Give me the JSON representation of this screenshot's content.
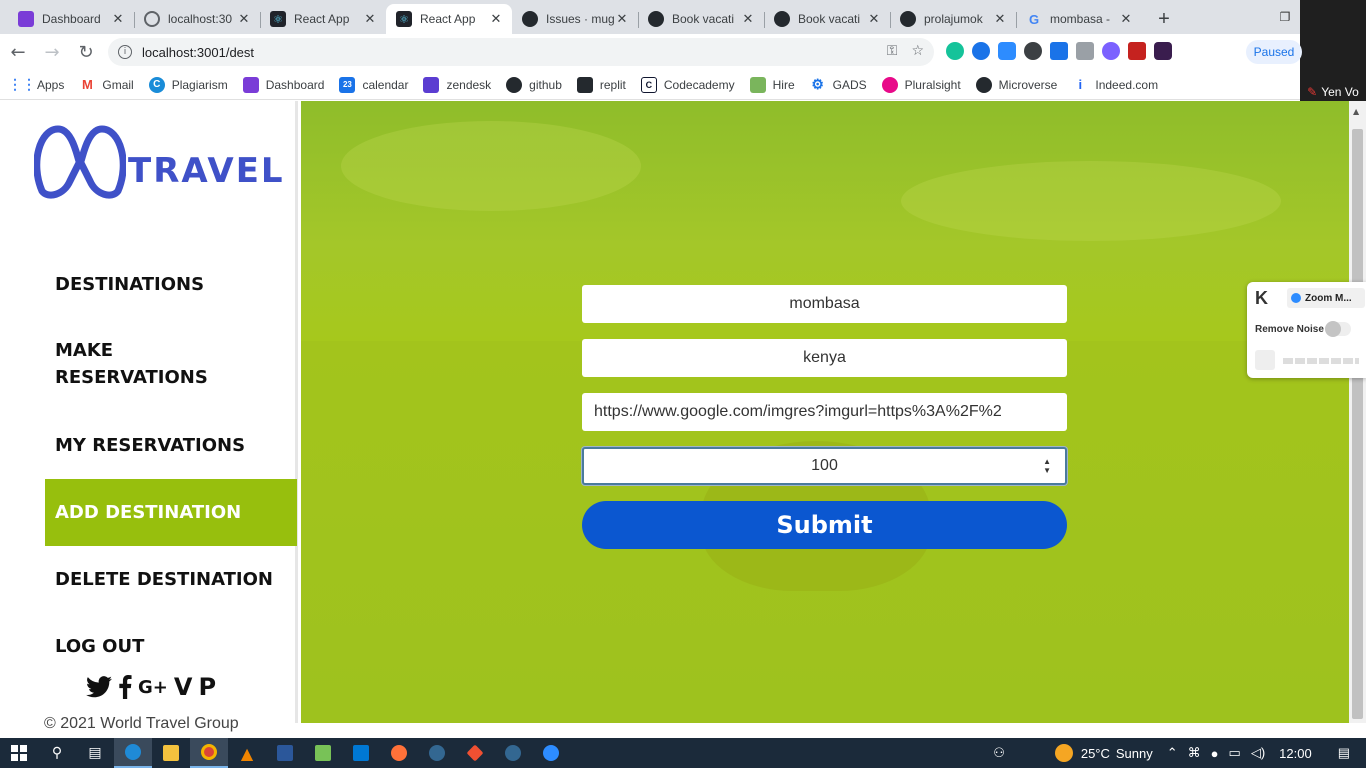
{
  "browser": {
    "tabs": [
      {
        "title": "Dashboard",
        "favicon": "dashboard-favicon",
        "color": "#7a3cd7",
        "active": false
      },
      {
        "title": "localhost:30",
        "favicon": "globe-favicon",
        "color": "#5f6368",
        "active": false
      },
      {
        "title": "React App",
        "favicon": "react-favicon",
        "color": "#20232a",
        "active": false
      },
      {
        "title": "React App",
        "favicon": "react-favicon",
        "color": "#20232a",
        "active": true
      },
      {
        "title": "Issues · mug",
        "favicon": "github-favicon",
        "color": "#24292e",
        "active": false
      },
      {
        "title": "Book vacati",
        "favicon": "github-favicon",
        "color": "#24292e",
        "active": false
      },
      {
        "title": "Book vacati",
        "favicon": "github-favicon",
        "color": "#24292e",
        "active": false
      },
      {
        "title": "prolajumok",
        "favicon": "github-favicon",
        "color": "#24292e",
        "active": false
      },
      {
        "title": "mombasa -",
        "favicon": "google-favicon",
        "color": "#ffffff",
        "active": false
      }
    ],
    "new_tab": "+",
    "url": "localhost:3001/dest",
    "profile_status": "Paused",
    "bookmarks": [
      {
        "label": "Apps",
        "icon": "apps-grid-icon",
        "color": "#4285f4"
      },
      {
        "label": "Gmail",
        "icon": "gmail-icon",
        "color": "#ea4335"
      },
      {
        "label": "Plagiarism",
        "icon": "plagiarism-icon",
        "color": "#1a8cd8"
      },
      {
        "label": "Dashboard",
        "icon": "dashboard-icon",
        "color": "#7a3cd7"
      },
      {
        "label": "calendar",
        "icon": "calendar-icon",
        "color": "#1a73e8"
      },
      {
        "label": "zendesk",
        "icon": "zendesk-icon",
        "color": "#5b3dd1"
      },
      {
        "label": "github",
        "icon": "github-icon",
        "color": "#24292e"
      },
      {
        "label": "replit",
        "icon": "replit-icon",
        "color": "#24292e"
      },
      {
        "label": "Codecademy",
        "icon": "codecademy-icon",
        "color": "#10162f"
      },
      {
        "label": "Hire",
        "icon": "shopify-icon",
        "color": "#7ab55c"
      },
      {
        "label": "GADS",
        "icon": "gear-icon",
        "color": "#1a73e8"
      },
      {
        "label": "Pluralsight",
        "icon": "pluralsight-icon",
        "color": "#e80a89"
      },
      {
        "label": "Microverse",
        "icon": "github-icon",
        "color": "#24292e"
      },
      {
        "label": "Indeed.com",
        "icon": "indeed-icon",
        "color": "#2164f3"
      }
    ],
    "zoom_user": "Yen Vo"
  },
  "sidebar": {
    "logo_text": "TRAVEL",
    "nav": [
      {
        "label": "DESTINATIONS",
        "active": false
      },
      {
        "label": "MAKE RESERVATIONS",
        "active": false
      },
      {
        "label": "MY RESERVATIONS",
        "active": false
      },
      {
        "label": "ADD DESTINATION",
        "active": true
      },
      {
        "label": "DELETE DESTINATION",
        "active": false
      },
      {
        "label": "LOG OUT",
        "active": false
      }
    ],
    "social_icons": [
      "twitter-icon",
      "facebook-icon",
      "google-plus-icon",
      "vimeo-icon",
      "pinterest-icon"
    ],
    "copyright": "© 2021 World Travel Group"
  },
  "form": {
    "city_value": "mombasa",
    "country_value": "kenya",
    "image_url_value": "https://www.google.com/imgres?imgurl=https%3A%2F%2",
    "price_value": "100",
    "submit_label": "Submit"
  },
  "zoom_panel": {
    "title": "Zoom M...",
    "remove_noise": "Remove Noise"
  },
  "taskbar": {
    "temperature": "25°C",
    "weather": "Sunny",
    "time": "12:00"
  },
  "colors": {
    "accent_green": "#97bf0d",
    "submit_blue": "#0b57d0",
    "logo_blue": "#3f51c8"
  }
}
